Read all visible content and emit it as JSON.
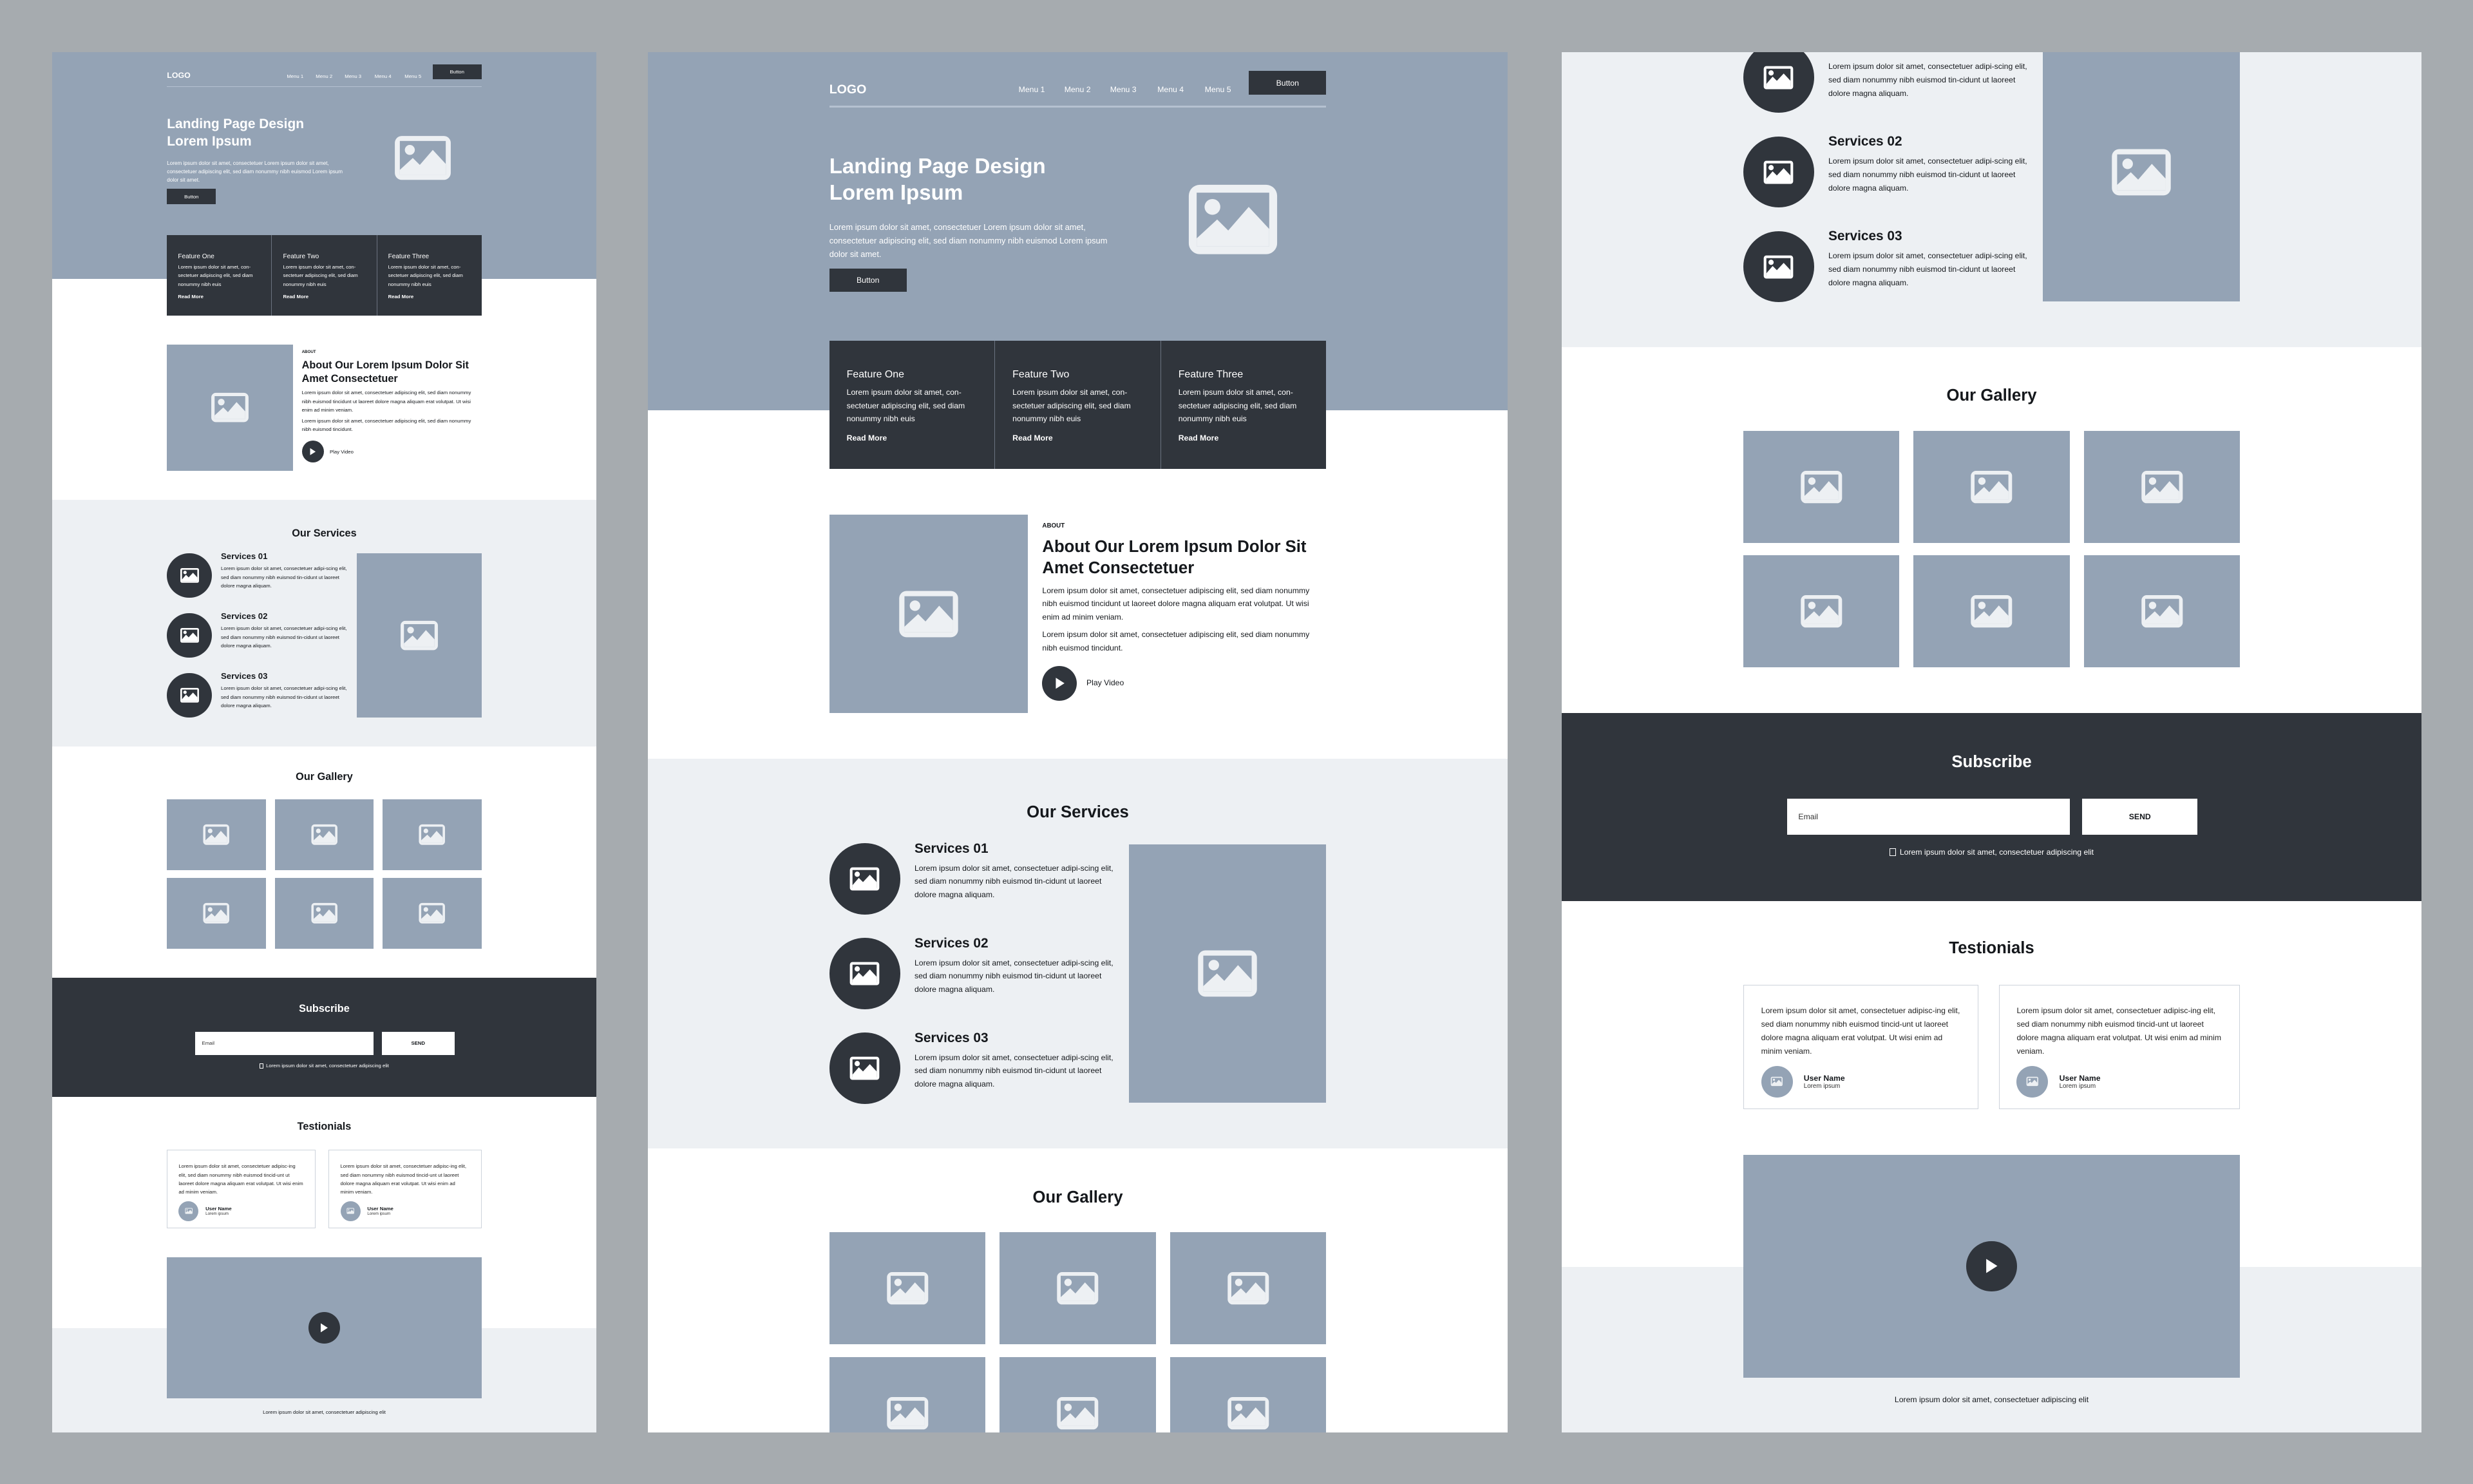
{
  "colors": {
    "hero": "#94a3b5",
    "dark": "#30353c",
    "light": "#edf0f3",
    "backdrop": "#a6abaf"
  },
  "nav": {
    "logo": "LOGO",
    "menus": [
      "Menu 1",
      "Menu 2",
      "Menu 3",
      "Menu 4",
      "Menu 5"
    ],
    "button": "Button"
  },
  "hero": {
    "title_line1": "Landing Page Design",
    "title_line2": "Lorem Ipsum",
    "text": "Lorem ipsum dolor sit amet, consectetuer Lorem ipsum dolor sit amet, consectetuer adipiscing elit, sed diam nonummy nibh euismod Lorem ipsum dolor sit amet.",
    "button": "Button",
    "image_icon": "image-icon"
  },
  "features": [
    {
      "title": "Feature One",
      "text": "Lorem ipsum dolor sit amet, con-sectetuer adipiscing elit, sed diam nonummy nibh euis",
      "link": "Read More"
    },
    {
      "title": "Feature Two",
      "text": "Lorem ipsum dolor sit amet, con-sectetuer adipiscing elit, sed diam nonummy nibh euis",
      "link": "Read More"
    },
    {
      "title": "Feature Three",
      "text": "Lorem ipsum dolor sit amet, con-sectetuer adipiscing elit, sed diam nonummy nibh euis",
      "link": "Read More"
    }
  ],
  "about": {
    "tag": "ABOUT",
    "heading": "About Our Lorem Ipsum Dolor Sit Amet Consectetuer",
    "para1": "Lorem ipsum dolor sit amet, consectetuer adipiscing elit, sed diam nonummy nibh euismod tincidunt ut laoreet dolore magna aliquam erat volutpat. Ut wisi enim ad minim veniam.",
    "para2": "Lorem ipsum dolor sit amet, consectetuer adipiscing elit, sed diam nonummy nibh euismod tincidunt.",
    "play": "Play Video"
  },
  "services": {
    "heading": "Our Services",
    "items": [
      {
        "title": "Services 01",
        "text": "Lorem ipsum dolor sit amet, consectetuer adipi-scing elit, sed diam nonummy nibh euismod tin-cidunt ut laoreet dolore magna aliquam."
      },
      {
        "title": "Services 02",
        "text": "Lorem ipsum dolor sit amet, consectetuer adipi-scing elit, sed diam nonummy nibh euismod tin-cidunt ut laoreet dolore magna aliquam."
      },
      {
        "title": "Services 03",
        "text": "Lorem ipsum dolor sit amet, consectetuer adipi-scing elit, sed diam nonummy nibh euismod tin-cidunt ut laoreet dolore magna aliquam."
      }
    ]
  },
  "gallery": {
    "heading": "Our Gallery"
  },
  "subscribe": {
    "heading": "Subscribe",
    "email_placeholder": "Email",
    "send": "SEND",
    "consent": "Lorem ipsum dolor sit amet, consectetuer adipiscing elit"
  },
  "testimonials": {
    "heading": "Testionials",
    "items": [
      {
        "text": "Lorem ipsum dolor sit amet, consectetuer adipisc-ing elit, sed diam nonummy nibh euismod tincid-unt ut laoreet dolore magna aliquam erat volutpat. Ut wisi enim ad minim veniam.",
        "name": "User Name",
        "role": "Lorem ipsum"
      },
      {
        "text": "Lorem ipsum dolor sit amet, consectetuer adipisc-ing elit, sed diam nonummy nibh euismod tincid-unt ut laoreet dolore magna aliquam erat volutpat. Ut wisi enim ad minim veniam.",
        "name": "User Name",
        "role": "Lorem ipsum"
      }
    ]
  },
  "footer": {
    "text": "Lorem ipsum dolor sit amet, consectetuer adipiscing elit"
  }
}
